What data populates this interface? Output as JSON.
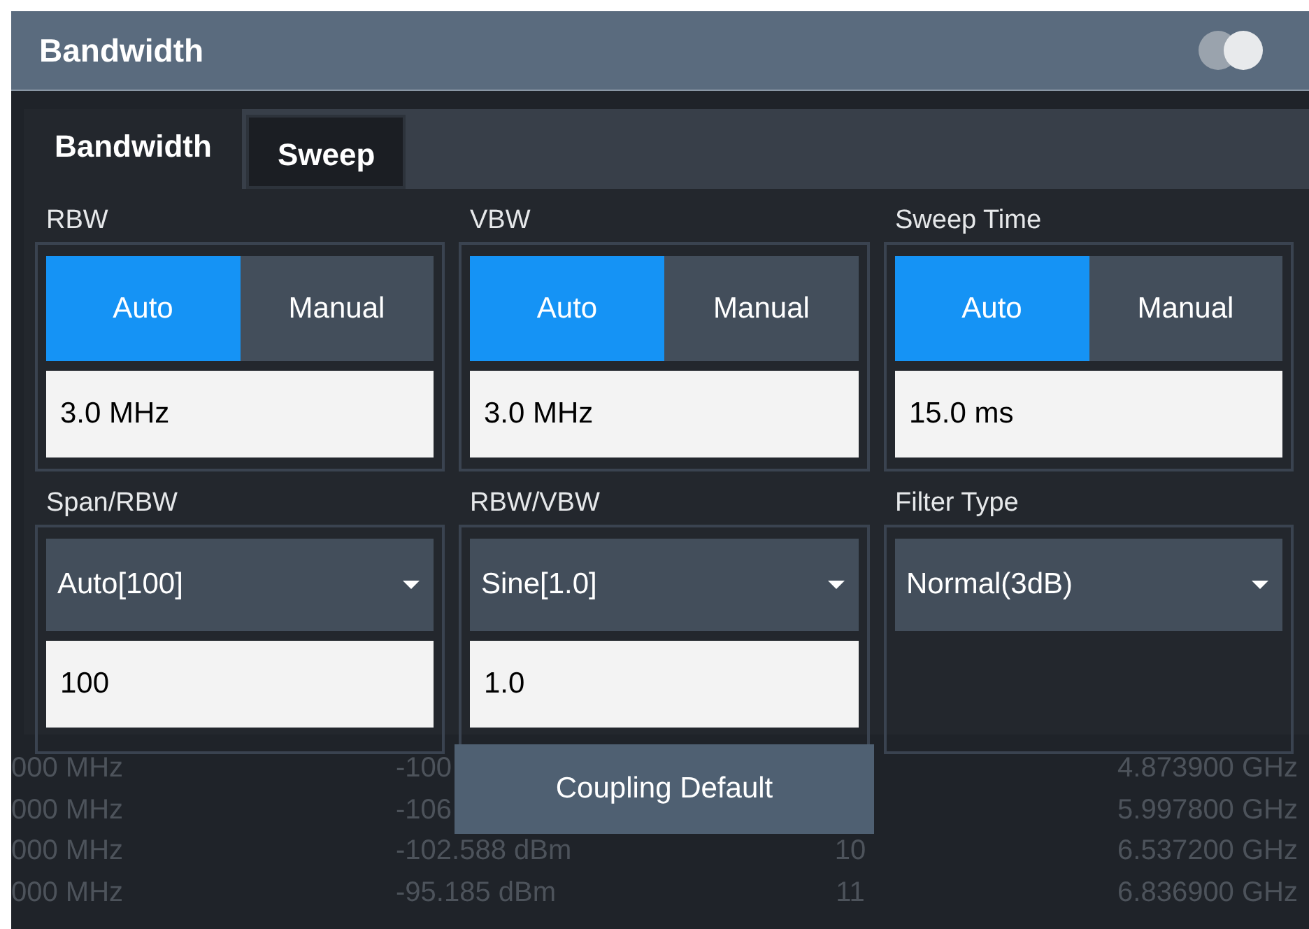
{
  "window": {
    "title": "Bandwidth"
  },
  "tabs": [
    {
      "label": "Bandwidth",
      "selected": true
    },
    {
      "label": "Sweep",
      "selected": false
    }
  ],
  "groups": [
    {
      "label": "RBW",
      "kind": "toggle",
      "options": [
        {
          "label": "Auto",
          "selected": true
        },
        {
          "label": "Manual",
          "selected": false
        }
      ],
      "value": "3.0 MHz"
    },
    {
      "label": "VBW",
      "kind": "toggle",
      "options": [
        {
          "label": "Auto",
          "selected": true
        },
        {
          "label": "Manual",
          "selected": false
        }
      ],
      "value": "3.0 MHz"
    },
    {
      "label": "Sweep Time",
      "kind": "toggle",
      "options": [
        {
          "label": "Auto",
          "selected": true
        },
        {
          "label": "Manual",
          "selected": false
        }
      ],
      "value": "15.0 ms"
    },
    {
      "label": "Span/RBW",
      "kind": "dropdown",
      "selection": "Auto[100]",
      "value": "100"
    },
    {
      "label": "RBW/VBW",
      "kind": "dropdown",
      "selection": "Sine[1.0]",
      "value": "1.0"
    },
    {
      "label": "Filter Type",
      "kind": "dropdown",
      "selection": "Normal(3dB)"
    }
  ],
  "button": {
    "label": "Coupling Default"
  },
  "background_table": {
    "rows": [
      {
        "column_1": "000 MHz",
        "column_2": "-100",
        "column_4": "4.873900 GHz"
      },
      {
        "column_1": "000 MHz",
        "column_2": "-106",
        "column_4": "5.997800 GHz"
      },
      {
        "column_1": "000 MHz",
        "column_2": "-102.588 dBm",
        "column_3": "10",
        "column_4": "6.537200 GHz"
      },
      {
        "column_1": "000 MHz",
        "column_2": "-95.185 dBm",
        "column_3": "11",
        "column_4": "6.836900 GHz"
      }
    ]
  }
}
